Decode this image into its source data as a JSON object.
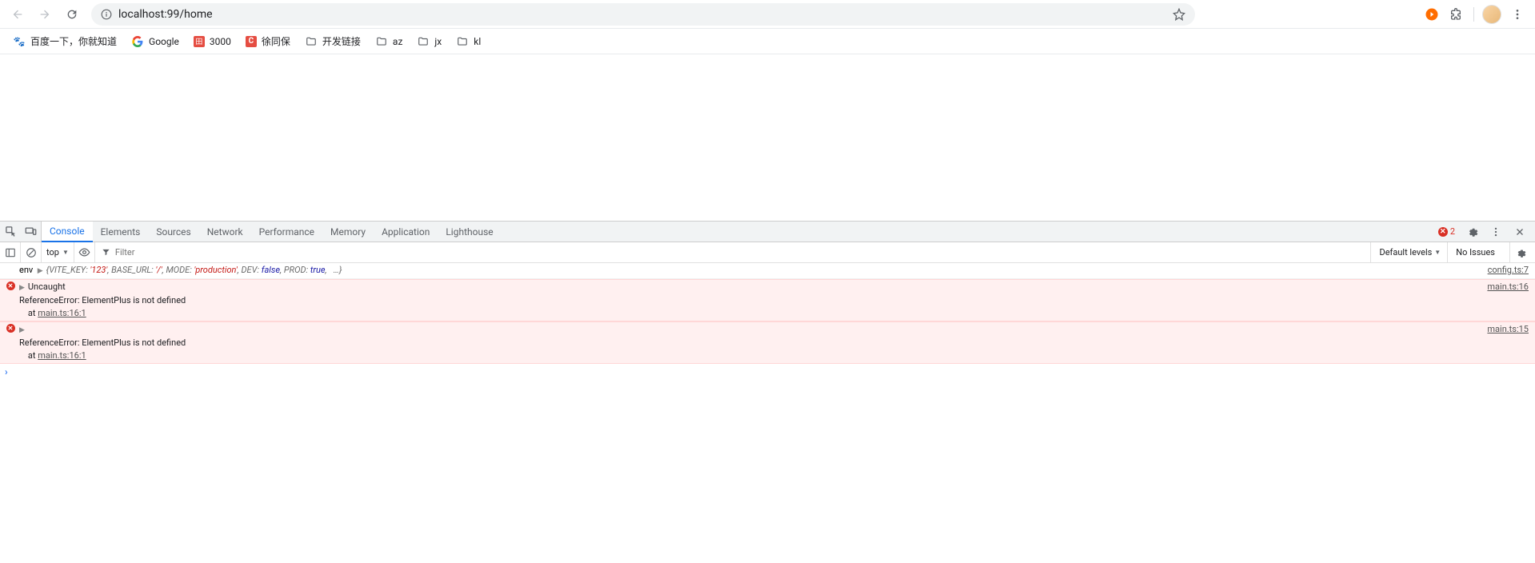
{
  "browser": {
    "url": "localhost:99/home",
    "bookmarks": [
      {
        "label": "百度一下，你就知道",
        "icon": "baidu"
      },
      {
        "label": "Google",
        "icon": "google"
      },
      {
        "label": "3000",
        "icon": "red"
      },
      {
        "label": "徐同保",
        "icon": "red-c"
      },
      {
        "label": "开发链接",
        "icon": "folder"
      },
      {
        "label": "az",
        "icon": "folder"
      },
      {
        "label": "jx",
        "icon": "folder"
      },
      {
        "label": "kl",
        "icon": "folder"
      }
    ]
  },
  "devtools": {
    "tabs": [
      "Console",
      "Elements",
      "Sources",
      "Network",
      "Performance",
      "Memory",
      "Application",
      "Lighthouse"
    ],
    "active_tab": "Console",
    "error_count": "2",
    "context": "top",
    "filter_placeholder": "Filter",
    "levels": "Default levels",
    "issues": "No Issues",
    "logs": [
      {
        "type": "log",
        "prefix": "env",
        "obj_parts": [
          "{",
          "VITE_KEY",
          ": ",
          "'123'",
          ", ",
          "BASE_URL",
          ": ",
          "'/'",
          ", ",
          "MODE",
          ": ",
          "'production'",
          ", ",
          "DEV",
          ": ",
          "false",
          ", ",
          "PROD",
          ": ",
          "true",
          ",   …}"
        ],
        "source": "config.ts:7"
      },
      {
        "type": "error",
        "lines": [
          "Uncaught",
          "ReferenceError: ElementPlus is not defined",
          "    at "
        ],
        "at_link": "main.ts:16:1",
        "source": "main.ts:16"
      },
      {
        "type": "error",
        "lines": [
          "",
          "ReferenceError: ElementPlus is not defined",
          "    at "
        ],
        "at_link": "main.ts:16:1",
        "source": "main.ts:15"
      }
    ]
  }
}
